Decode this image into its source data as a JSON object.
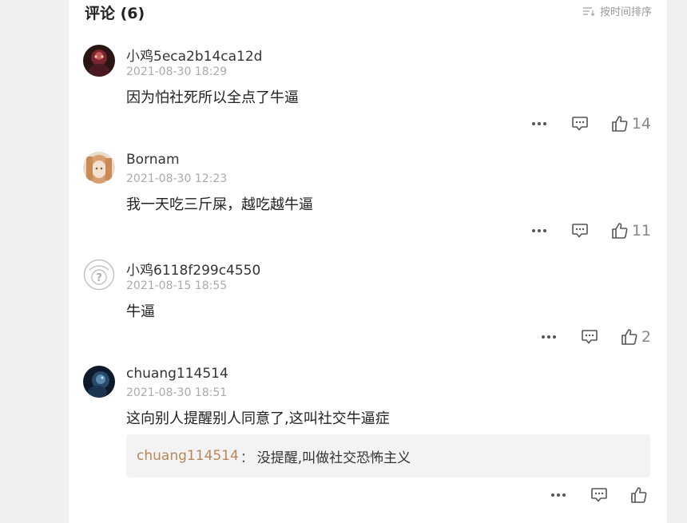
{
  "header": {
    "title": "评论 (6)",
    "sort_label": "按时间排序"
  },
  "comments": [
    {
      "username": "小鸡5eca2b14ca12d",
      "time": "2021-08-30 18:29",
      "text": "因为怕社死所以全点了牛逼",
      "likes": "14",
      "avatar": "dark-red-character-avatar"
    },
    {
      "username": "Bornam",
      "time": "2021-08-30 12:23",
      "text": "我一天吃三斤屎，越吃越牛逼",
      "likes": "11",
      "avatar": "anime-girl-avatar"
    },
    {
      "username": "小鸡6118f299c4550",
      "time": "2021-08-15 18:55",
      "text": "牛逼",
      "likes": "2",
      "avatar": "default-question-avatar"
    },
    {
      "username": "chuang114514",
      "time": "2021-08-30 18:51",
      "text": "这向别人提醒别人同意了,这叫社交牛逼症",
      "likes": "",
      "avatar": "dark-blue-character-avatar",
      "reply": {
        "username": "chuang114514",
        "separator": "：",
        "text": "没提醒,叫做社交恐怖主义"
      }
    }
  ],
  "icons": {
    "more": "more-dots-icon",
    "reply": "comment-bubble-icon",
    "like": "thumbs-up-icon",
    "sort": "sort-icon"
  }
}
